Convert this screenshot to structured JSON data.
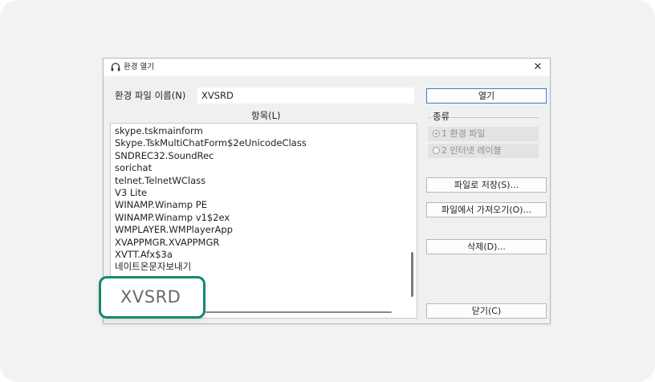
{
  "dialog": {
    "title": "환경 열기",
    "close_glyph": "✕",
    "icon": "headset-icon"
  },
  "filename": {
    "label": "환경 파일 이름(N)",
    "value": "XVSRD"
  },
  "list": {
    "header": "항목(L)",
    "items": [
      "skype.tskmainform",
      "Skype.TskMultiChatForm$2eUnicodeClass",
      "SNDREC32.SoundRec",
      "sorichat",
      "telnet.TelnetWClass",
      "V3 Lite",
      "WINAMP.Winamp PE",
      "WINAMP.Winamp v1$2ex",
      "WMPLAYER.WMPlayerApp",
      "XVAPPMGR.XVAPPMGR",
      "XVTT.Afx$3a",
      "네이트온문자보내기"
    ]
  },
  "kind": {
    "title": "종류",
    "options": [
      "1 환경 파일",
      "2 인터넷 레이블"
    ],
    "selected": "1 환경 파일"
  },
  "buttons": {
    "open": "열기",
    "save_to_file": "파일로 저장(S)...",
    "load_from_file": "파일에서 가져오기(O)...",
    "delete": "삭제(D)...",
    "close": "닫기(C)"
  },
  "callout": {
    "text": "XVSRD"
  },
  "colors": {
    "callout_border": "#17876d",
    "default_button_border": "#3c7fd4"
  }
}
